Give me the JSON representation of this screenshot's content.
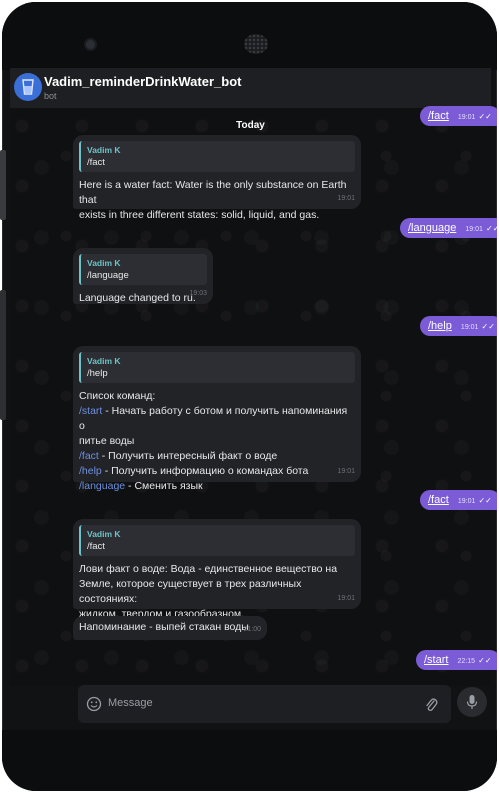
{
  "header": {
    "title": "Vadim_reminderDrinkWater_bot",
    "subtitle": "bot"
  },
  "chat": {
    "date_divider": "Today",
    "messages": [
      {
        "dir": "out",
        "text": "/fact",
        "time": "19:01"
      },
      {
        "dir": "in",
        "quote_name": "Vadim K",
        "quote_text": "/fact",
        "lines": [
          "Here is a water fact: Water is the only substance on Earth that",
          "exists in three different states: solid, liquid, and gas."
        ],
        "time": "19:01"
      },
      {
        "dir": "out",
        "text": "/language",
        "time": "19:01"
      },
      {
        "dir": "in",
        "quote_name": "Vadim K",
        "quote_text": "/language",
        "lines": [
          "Language changed to ru."
        ],
        "time": "19:03"
      },
      {
        "dir": "out",
        "text": "/help",
        "time": "19:01"
      },
      {
        "dir": "in",
        "quote_name": "Vadim K",
        "quote_text": "/help",
        "lines": [
          "Список команд:"
        ],
        "commands": [
          {
            "cmd": "/start",
            "desc": " - Начать работу с ботом и получить напоминания о"
          },
          {
            "cmd": "",
            "desc": "питье воды"
          },
          {
            "cmd": "/fact",
            "desc": " - Получить интересный факт о воде"
          },
          {
            "cmd": "/help",
            "desc": " - Получить информацию о командах бота"
          },
          {
            "cmd": "/language",
            "desc": " - Сменить язык"
          }
        ],
        "time": "19:01"
      },
      {
        "dir": "out",
        "text": "/fact",
        "time": "19:01"
      },
      {
        "dir": "in",
        "quote_name": "Vadim K",
        "quote_text": "/fact",
        "lines": [
          "Лови факт о воде: Вода - единственное вещество на",
          "Земле, которое существует в трех различных состояниях:",
          "жидком, твердом и газообразном."
        ],
        "time": "19:01"
      },
      {
        "dir": "in",
        "lines": [
          "Напоминание - выпей стакан воды"
        ],
        "time": "21:00"
      },
      {
        "dir": "out",
        "text": "/start",
        "time": "22:15"
      }
    ]
  },
  "composer": {
    "placeholder": "Message"
  },
  "icons": {
    "emoji": "emoji-icon",
    "attach": "paperclip-icon",
    "mic": "microphone-icon",
    "check": "double-check-icon"
  },
  "colors": {
    "outgoing": "#7b5bd6",
    "incoming": "#222327",
    "quote_accent": "#6fc3c6",
    "link": "#6e8fe0"
  }
}
